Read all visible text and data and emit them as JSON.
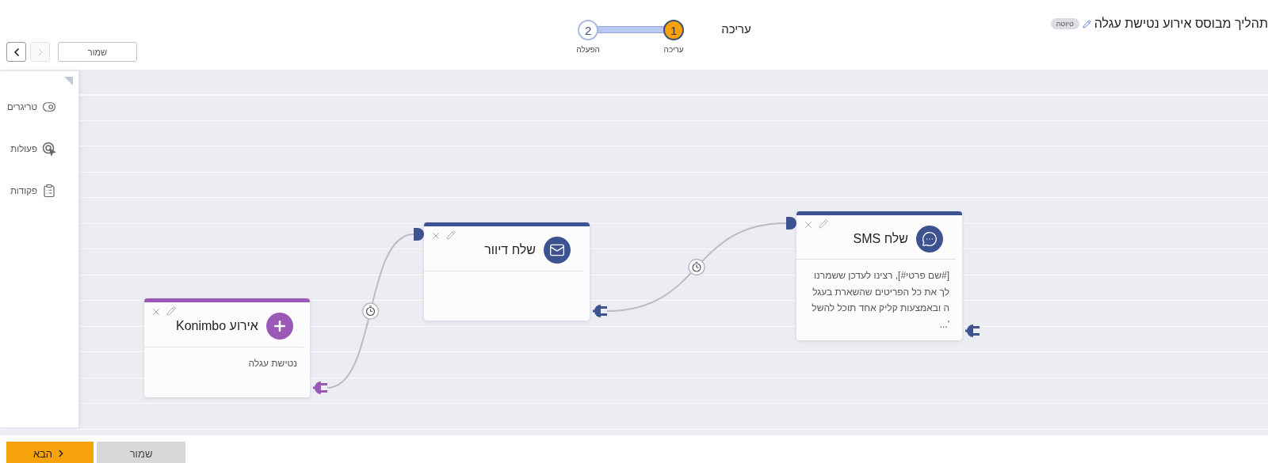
{
  "header": {
    "title": "תהליך מבוסס אירוע נטישת עגלה",
    "badge": "טיוטה",
    "section_title": "עריכה",
    "steps": [
      {
        "number": "1",
        "label": "עריכה",
        "selected": true
      },
      {
        "number": "2",
        "label": "הפעלה",
        "selected": false
      }
    ],
    "nav": [
      {
        "kind": "prev",
        "disabled": false
      },
      {
        "kind": "next",
        "disabled": true
      }
    ],
    "save_button": "שמור"
  },
  "sidebar": {
    "items": [
      {
        "kind": "trigger",
        "label": "טריגרים"
      },
      {
        "kind": "action",
        "label": "פעולות"
      },
      {
        "kind": "command",
        "label": "פקודות"
      }
    ]
  },
  "nodes": [
    {
      "kind": "event",
      "title": "אירוע Konimbo",
      "color": "#9b59b6",
      "body_lines": [
        "נטישת עגלה"
      ]
    },
    {
      "kind": "mail",
      "title": "שלח דיוור",
      "color": "#3d5391"
    },
    {
      "kind": "sms",
      "title": "שלח SMS",
      "color": "#3d5391",
      "body_lines": [
        "[#שם פרטי#], רצינו לעדכן ששמרנו",
        "לך את כל הפריטים שהשארת בעגל",
        "ה ובאמצעות קליק אחד תוכל להשל",
        "'..."
      ]
    }
  ],
  "footer": {
    "next_button": "הבא",
    "save_button": "שמור"
  }
}
